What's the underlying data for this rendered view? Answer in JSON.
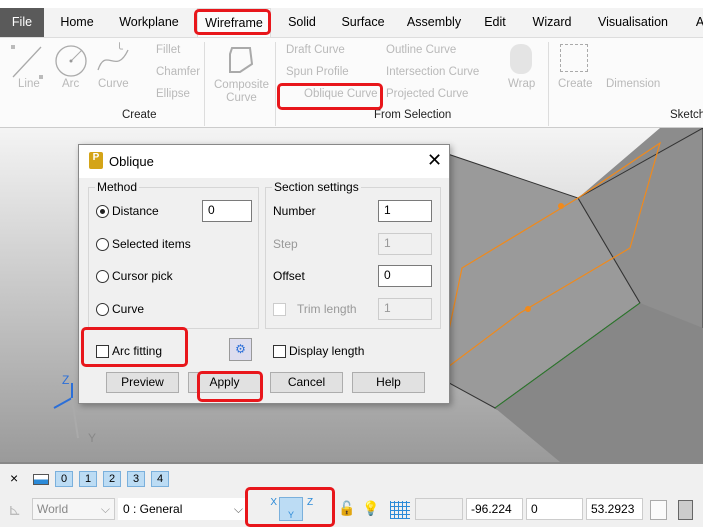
{
  "tabs": [
    "File",
    "Home",
    "Workplane",
    "Wireframe",
    "Solid",
    "Surface",
    "Assembly",
    "Edit",
    "Wizard",
    "Visualisation",
    "A"
  ],
  "ribbon": {
    "create": {
      "line": "Line",
      "arc": "Arc",
      "curve": "Curve",
      "fillet": "Fillet",
      "chamfer": "Chamfer",
      "ellipse": "Ellipse",
      "composite1": "Composite",
      "composite2": "Curve",
      "group": "Create"
    },
    "from_selection": {
      "draft": "Draft Curve",
      "spun": "Spun Profile",
      "oblique": "Oblique Curve",
      "outline": "Outline Curve",
      "intersection": "Intersection Curve",
      "projected": "Projected Curve",
      "wrap": "Wrap",
      "group": "From Selection"
    },
    "sketch": {
      "create": "Create",
      "dimension": "Dimension",
      "group": "Sketch"
    }
  },
  "dialog": {
    "title": "Oblique",
    "method": {
      "legend": "Method",
      "distance": "Distance",
      "distance_value": "0",
      "selected_items": "Selected items",
      "cursor_pick": "Cursor pick",
      "curve": "Curve",
      "selected": "Distance"
    },
    "section": {
      "legend": "Section settings",
      "number": "Number",
      "number_value": "1",
      "step": "Step",
      "step_value": "1",
      "offset": "Offset",
      "offset_value": "0",
      "trim_length": "Trim length",
      "trim_value": "1"
    },
    "arc_fitting": "Arc fitting",
    "display_length": "Display length",
    "buttons": {
      "preview": "Preview",
      "apply": "Apply",
      "cancel": "Cancel",
      "help": "Help"
    }
  },
  "axes": {
    "z": "Z",
    "y": "Y"
  },
  "bottom": {
    "close": "×",
    "layers": [
      "0",
      "1",
      "2",
      "3",
      "4"
    ],
    "workplane": "World",
    "level": "0   : General",
    "coords": {
      "blank": "",
      "x": "-96.224",
      "y": "0",
      "z": "53.2923"
    },
    "axis_labels": {
      "x": "X",
      "y": "Y",
      "z": "Z"
    }
  },
  "colors": {
    "highlight": "#e8161b",
    "accent": "#2b8ad8",
    "curve": "#f08a1c"
  }
}
